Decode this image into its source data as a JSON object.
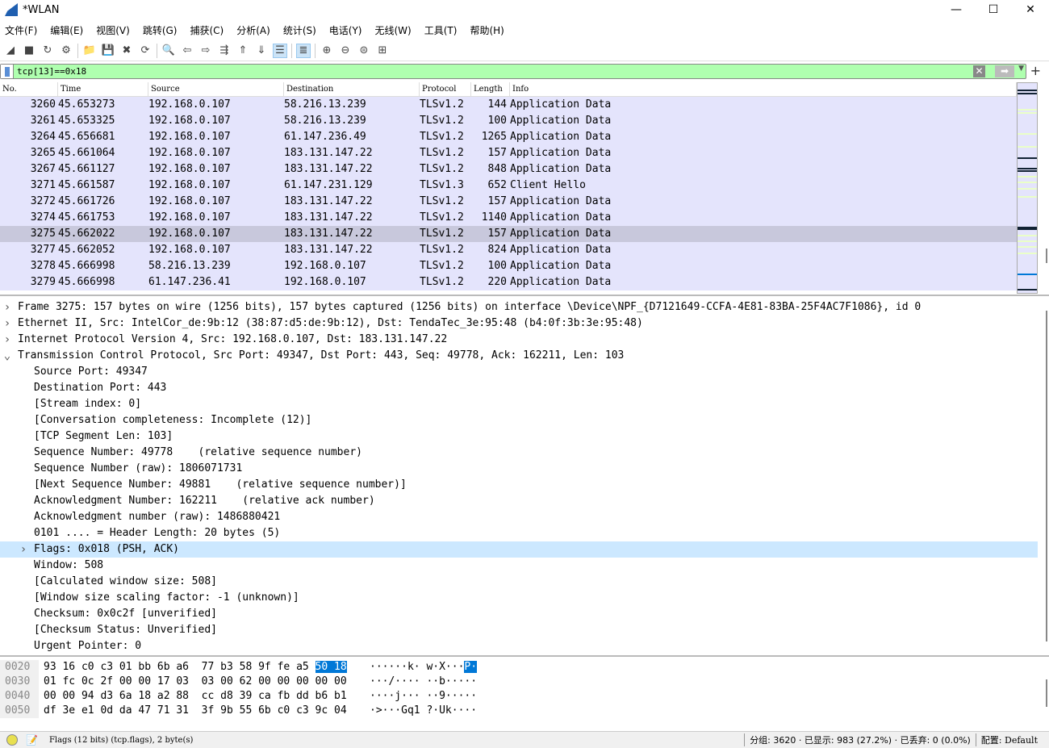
{
  "window": {
    "title": "*WLAN"
  },
  "menu": [
    "文件(F)",
    "编辑(E)",
    "视图(V)",
    "跳转(G)",
    "捕获(C)",
    "分析(A)",
    "统计(S)",
    "电话(Y)",
    "无线(W)",
    "工具(T)",
    "帮助(H)"
  ],
  "toolbar": [
    "shark-fin-icon",
    "stop-icon",
    "restart-icon",
    "options-icon",
    "|",
    "open-folder-icon",
    "save-icon",
    "close-file-icon",
    "reload-icon",
    "|",
    "find-icon",
    "back-icon",
    "forward-icon",
    "goto-icon",
    "first-icon",
    "last-icon",
    "autoscroll-icon",
    "|",
    "colorize-icon",
    "|",
    "zoom-in-icon",
    "zoom-out-icon",
    "zoom-normal-icon",
    "resize-columns-icon"
  ],
  "filter": {
    "value": "tcp[13]==0x18",
    "accent": "#afffaf"
  },
  "columns": [
    "No.",
    "Time",
    "Source",
    "Destination",
    "Protocol",
    "Length",
    "Info"
  ],
  "packets": [
    [
      "3260",
      "45.653273",
      "192.168.0.107",
      "58.216.13.239",
      "TLSv1.2",
      "144",
      "Application Data"
    ],
    [
      "3261",
      "45.653325",
      "192.168.0.107",
      "58.216.13.239",
      "TLSv1.2",
      "100",
      "Application Data"
    ],
    [
      "3264",
      "45.656681",
      "192.168.0.107",
      "61.147.236.49",
      "TLSv1.2",
      "1265",
      "Application Data"
    ],
    [
      "3265",
      "45.661064",
      "192.168.0.107",
      "183.131.147.22",
      "TLSv1.2",
      "157",
      "Application Data"
    ],
    [
      "3267",
      "45.661127",
      "192.168.0.107",
      "183.131.147.22",
      "TLSv1.2",
      "848",
      "Application Data"
    ],
    [
      "3271",
      "45.661587",
      "192.168.0.107",
      "61.147.231.129",
      "TLSv1.3",
      "652",
      "Client Hello"
    ],
    [
      "3272",
      "45.661726",
      "192.168.0.107",
      "183.131.147.22",
      "TLSv1.2",
      "157",
      "Application Data"
    ],
    [
      "3274",
      "45.661753",
      "192.168.0.107",
      "183.131.147.22",
      "TLSv1.2",
      "1140",
      "Application Data"
    ],
    [
      "3275",
      "45.662022",
      "192.168.0.107",
      "183.131.147.22",
      "TLSv1.2",
      "157",
      "Application Data"
    ],
    [
      "3277",
      "45.662052",
      "192.168.0.107",
      "183.131.147.22",
      "TLSv1.2",
      "824",
      "Application Data"
    ],
    [
      "3278",
      "45.666998",
      "58.216.13.239",
      "192.168.0.107",
      "TLSv1.2",
      "100",
      "Application Data"
    ],
    [
      "3279",
      "45.666998",
      "61.147.236.41",
      "192.168.0.107",
      "TLSv1.2",
      "220",
      "Application Data"
    ]
  ],
  "selected_packet": "3275",
  "details": [
    {
      "t": "Frame 3275: 157 bytes on wire (1256 bits), 157 bytes captured (1256 bits) on interface \\Device\\NPF_{D7121649-CCFA-4E81-83BA-25F4AC7F1086}, id 0",
      "lvl": 0,
      "exp": "collapsed"
    },
    {
      "t": "Ethernet II, Src: IntelCor_de:9b:12 (38:87:d5:de:9b:12), Dst: TendaTec_3e:95:48 (b4:0f:3b:3e:95:48)",
      "lvl": 0,
      "exp": "collapsed"
    },
    {
      "t": "Internet Protocol Version 4, Src: 192.168.0.107, Dst: 183.131.147.22",
      "lvl": 0,
      "exp": "collapsed"
    },
    {
      "t": "Transmission Control Protocol, Src Port: 49347, Dst Port: 443, Seq: 49778, Ack: 162211, Len: 103",
      "lvl": 0,
      "exp": "expanded"
    },
    {
      "t": "Source Port: 49347",
      "lvl": 1
    },
    {
      "t": "Destination Port: 443",
      "lvl": 1
    },
    {
      "t": "[Stream index: 0]",
      "lvl": 1
    },
    {
      "t": "[Conversation completeness: Incomplete (12)]",
      "lvl": 1
    },
    {
      "t": "[TCP Segment Len: 103]",
      "lvl": 1
    },
    {
      "t": "Sequence Number: 49778    (relative sequence number)",
      "lvl": 1
    },
    {
      "t": "Sequence Number (raw): 1806071731",
      "lvl": 1
    },
    {
      "t": "[Next Sequence Number: 49881    (relative sequence number)]",
      "lvl": 1
    },
    {
      "t": "Acknowledgment Number: 162211    (relative ack number)",
      "lvl": 1
    },
    {
      "t": "Acknowledgment number (raw): 1486880421",
      "lvl": 1
    },
    {
      "t": "0101 .... = Header Length: 20 bytes (5)",
      "lvl": 1
    },
    {
      "t": "Flags: 0x018 (PSH, ACK)",
      "lvl": 1,
      "exp": "collapsed",
      "selected": true
    },
    {
      "t": "Window: 508",
      "lvl": 1
    },
    {
      "t": "[Calculated window size: 508]",
      "lvl": 1
    },
    {
      "t": "[Window size scaling factor: -1 (unknown)]",
      "lvl": 1
    },
    {
      "t": "Checksum: 0x0c2f [unverified]",
      "lvl": 1
    },
    {
      "t": "[Checksum Status: Unverified]",
      "lvl": 1
    },
    {
      "t": "Urgent Pointer: 0",
      "lvl": 1
    }
  ],
  "hex": [
    {
      "off": "0020",
      "a": "93 16 c0 c3 01 bb 6b a6  77 b3 58 9f fe a5 ",
      "h": "50 18",
      "ascii": "······k· w·X···",
      "ah": "P·"
    },
    {
      "off": "0030",
      "a": "01 fc 0c 2f 00 00 17 03  03 00 62 00 00 00 00 00",
      "h": "",
      "ascii": "···/···· ··b·····",
      "ah": ""
    },
    {
      "off": "0040",
      "a": "00 00 94 d3 6a 18 a2 88  cc d8 39 ca fb dd b6 b1",
      "h": "",
      "ascii": "····j··· ··9·····",
      "ah": ""
    },
    {
      "off": "0050",
      "a": "df 3e e1 0d da 47 71 31  3f 9b 55 6b c0 c3 9c 04",
      "h": "",
      "ascii": "·>···Gq1 ?·Uk····",
      "ah": ""
    }
  ],
  "status": {
    "message": "Flags (12 bits) (tcp.flags), 2 byte(s)",
    "packets": "分组: 3620 · 已显示: 983 (27.2%) · 已丢弃: 0 (0.0%)",
    "profile": "配置: Default"
  },
  "colors": {
    "row_bg": "#e4e4fc",
    "row_selected": "#c8c8dc",
    "detail_selected": "#cce8ff",
    "hex_highlight": "#0078d7"
  }
}
